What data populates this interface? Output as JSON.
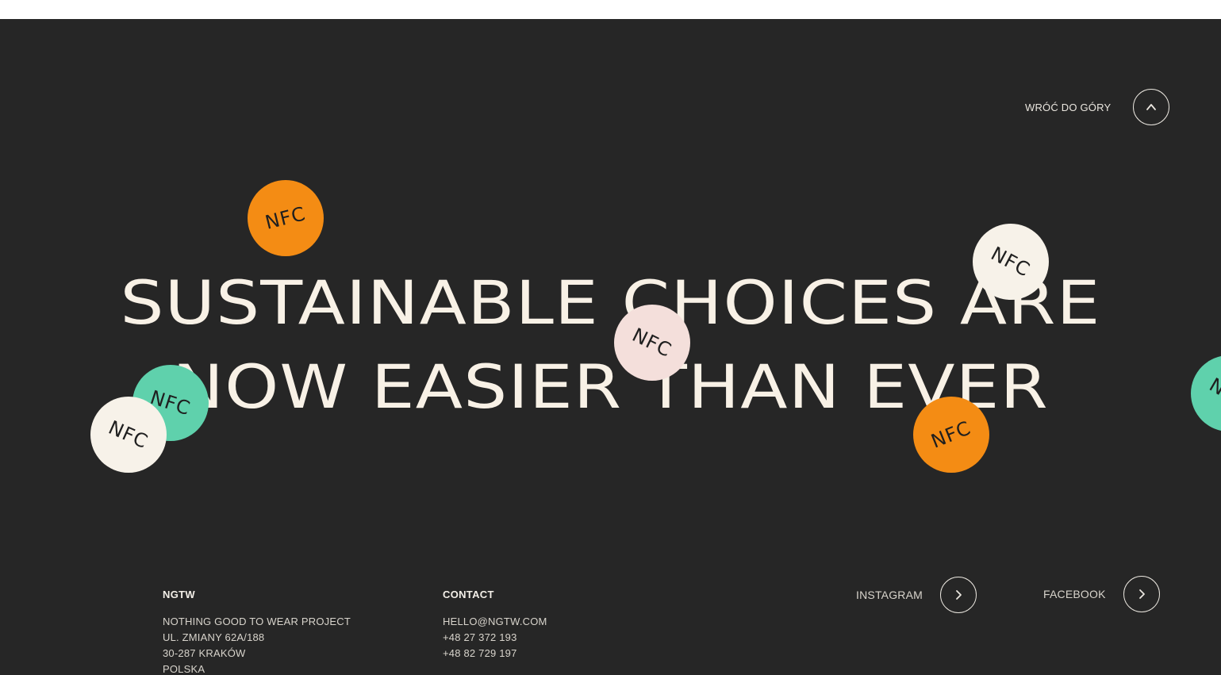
{
  "back_to_top": {
    "label": "WRÓĆ DO GÓRY"
  },
  "headline": {
    "line1": "SUSTAINABLE CHOICES ARE",
    "line2": "NOW EASIER THAN EVER"
  },
  "sticker_text": "NFC",
  "footer": {
    "brand": {
      "title": "NGTW",
      "lines": [
        "NOTHING GOOD TO WEAR PROJECT",
        "UL. ZMIANY 62A/188",
        "30-287 KRAKÓW",
        "POLSKA"
      ]
    },
    "contact": {
      "title": "CONTACT",
      "lines": [
        "HELLO@NGTW.COM",
        "+48 27 372 193",
        "+48 82 729 197"
      ]
    },
    "social": [
      {
        "label": "INSTAGRAM"
      },
      {
        "label": "FACEBOOK"
      }
    ]
  },
  "colors": {
    "background": "#262626",
    "orange": "#f48c14",
    "cream": "#f7f2e9",
    "pink": "#f4dfdb",
    "mint": "#5fd1ac",
    "text": "#f8f1e6"
  }
}
